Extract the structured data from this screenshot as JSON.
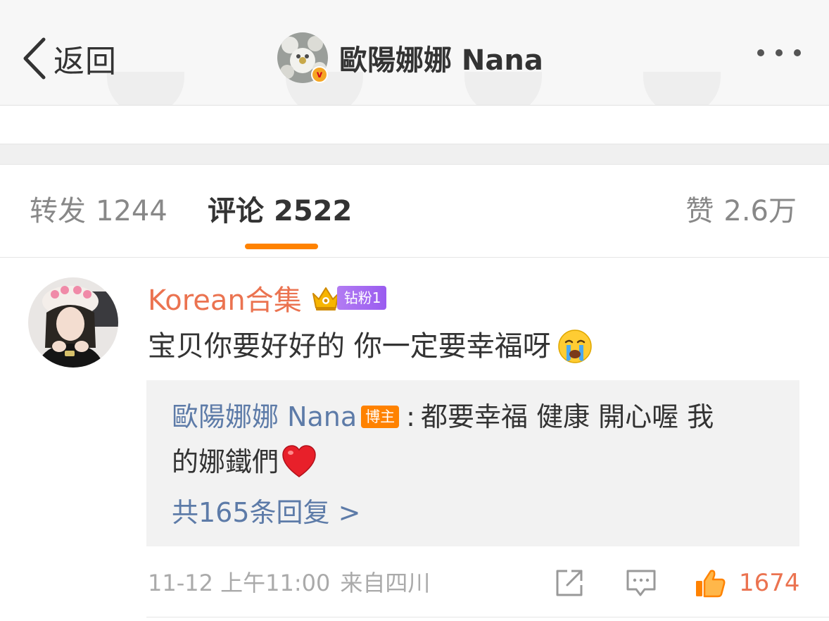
{
  "header": {
    "back_label": "返回",
    "title": "歐陽娜娜 Nana",
    "verified_badge": "v",
    "more_icon": "more-dots-icon"
  },
  "tabs": {
    "repost": {
      "label": "转发",
      "count": "1244"
    },
    "comment": {
      "label": "评论",
      "count": "2522",
      "active": true
    },
    "like": {
      "label": "赞",
      "count": "2.6万"
    }
  },
  "comment": {
    "username": "Korean合集",
    "fan_badge": "钻粉1",
    "text": "宝贝你要好好的 你一定要幸福呀",
    "emoji": "crying-face",
    "reply": {
      "author": "歐陽娜娜 Nana",
      "author_badge": "博主",
      "colon": ":",
      "text_line1": "都要幸福 健康 開心喔 我",
      "text_line2": "的娜鐵們",
      "emoji": "red-heart",
      "more_label": "共165条回复 >"
    },
    "date": "11-12 上午11:00",
    "location": "来自四川",
    "like_count": "1674"
  },
  "colors": {
    "accent": "#ff8200",
    "username": "#eb7350",
    "link": "#5d7ba8",
    "muted": "#aaaaaa"
  }
}
